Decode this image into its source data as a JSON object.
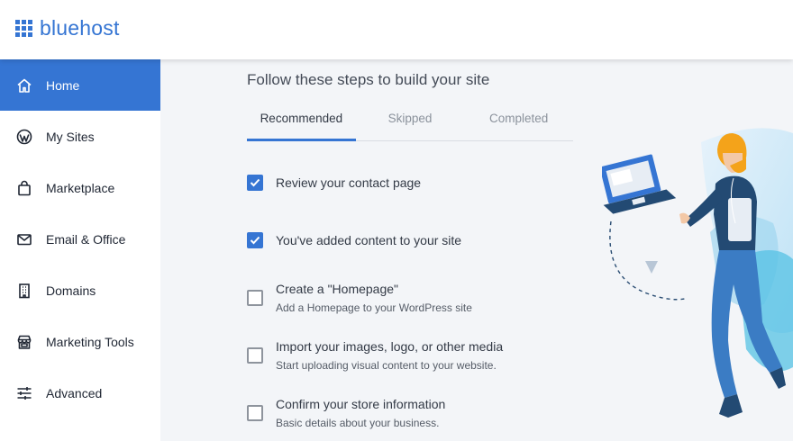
{
  "brand": {
    "name": "bluehost",
    "color": "#3575d3"
  },
  "sidebar": {
    "items": [
      {
        "label": "Home",
        "icon": "home-icon",
        "active": true
      },
      {
        "label": "My Sites",
        "icon": "wordpress-icon",
        "active": false
      },
      {
        "label": "Marketplace",
        "icon": "shopping-bag-icon",
        "active": false
      },
      {
        "label": "Email & Office",
        "icon": "envelope-icon",
        "active": false
      },
      {
        "label": "Domains",
        "icon": "building-icon",
        "active": false
      },
      {
        "label": "Marketing Tools",
        "icon": "storefront-icon",
        "active": false
      },
      {
        "label": "Advanced",
        "icon": "sliders-icon",
        "active": false
      }
    ]
  },
  "main": {
    "heading": "Follow these steps to build your site",
    "tabs": [
      {
        "label": "Recommended",
        "active": true
      },
      {
        "label": "Skipped",
        "active": false
      },
      {
        "label": "Completed",
        "active": false
      }
    ],
    "tasks": [
      {
        "title": "Review your contact page",
        "description": "",
        "checked": true
      },
      {
        "title": "You've added content to your site",
        "description": "",
        "checked": true
      },
      {
        "title": "Create a \"Homepage\"",
        "description": "Add a Homepage to your WordPress site",
        "checked": false
      },
      {
        "title": "Import your images, logo, or other media",
        "description": "Start uploading visual content to your website.",
        "checked": false
      },
      {
        "title": "Confirm your store information",
        "description": "Basic details about your business.",
        "checked": false
      }
    ]
  }
}
